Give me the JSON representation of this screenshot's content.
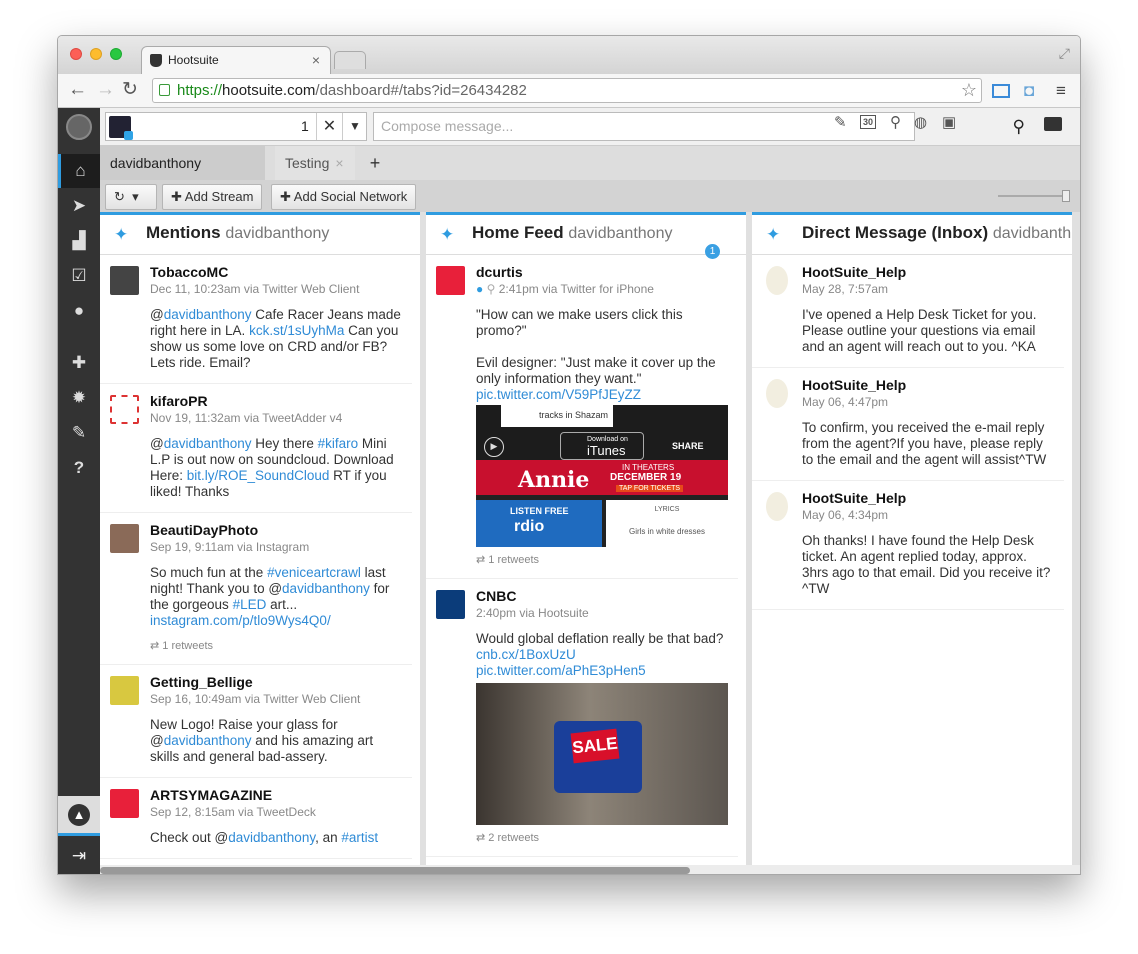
{
  "browser": {
    "tab_title": "Hootsuite",
    "tab_close": "×",
    "url_scheme": "https://",
    "url_host": "hootsuite.com",
    "url_path": "/dashboard#/tabs?id=26434282"
  },
  "compose": {
    "profile_count": "1",
    "placeholder": "Compose message...",
    "calendar_day": "30"
  },
  "tabs": [
    {
      "label": "davidbanthony (Twitter)",
      "close": "×"
    },
    {
      "label": "Testing",
      "close": "×"
    }
  ],
  "add_tab": "+",
  "actions": {
    "add_stream": "Add Stream",
    "add_social_network": "Add Social Network"
  },
  "columns": [
    {
      "title": "Mentions",
      "user": "davidbanthony",
      "messages": [
        {
          "name": "TobaccoMC",
          "meta": "Dec 11, 10:23am via Twitter Web Client",
          "parts": [
            "@",
            "davidbanthony",
            " Cafe Racer Jeans made right here in LA. ",
            "kck.st/1sUyhMa",
            " Can you show us some love on CRD and/or FB? Lets ride. Email?"
          ]
        },
        {
          "name": "kifaroPR",
          "meta": "Nov 19, 11:32am via TweetAdder v4",
          "parts": [
            "@",
            "davidbanthony",
            " Hey there ",
            "#kifaro",
            " Mini L.P is out now on soundcloud. Download Here: ",
            "bit.ly/ROE_SoundCloud",
            " RT if you liked! Thanks"
          ]
        },
        {
          "name": "BeautiDayPhoto",
          "meta": "Sep 19, 9:11am via Instagram",
          "parts": [
            "So much fun at the ",
            "#veniceartcrawl",
            " last night! Thank you to @",
            "davidbanthony",
            " for the gorgeous ",
            "#LED",
            " art... ",
            "instagram.com/p/tlo9Wys4Q0/",
            ""
          ],
          "retweets": "1 retweets"
        },
        {
          "name": "Getting_Bellige",
          "meta": "Sep 16, 10:49am via Twitter Web Client",
          "parts": [
            "New Logo! Raise your glass for @",
            "davidbanthony",
            " and his amazing art skills and general bad-assery."
          ]
        },
        {
          "name": "ARTSYMAGAZINE",
          "meta": "Sep 12, 8:15am via TweetDeck",
          "parts": [
            "Check out @",
            "davidbanthony",
            ", an ",
            "#artist",
            ""
          ]
        }
      ]
    },
    {
      "title": "Home Feed",
      "user": "davidbanthony",
      "badge": "1",
      "messages": [
        {
          "name": "dcurtis",
          "meta": "2:41pm via Twitter for iPhone",
          "parts": [
            "\"How can we make users click this promo?\"\n\nEvil designer: \"Just make it cover up the only information they want.\"\n",
            "pic.twitter.com/V59PfJEyZZ",
            ""
          ],
          "media": {
            "itunes_small": "Download on",
            "itunes": "iTunes",
            "share": "SHARE",
            "shazam": "tracks in Shazam",
            "movie": "Annie",
            "in_theaters": "IN THEATERS",
            "date": "DECEMBER 19",
            "tickets": "TAP FOR TICKETS",
            "listen": "LISTEN FREE",
            "rdio": "rdio",
            "lyrics": "LYRICS",
            "lyric_line": "Girls in white dresses"
          },
          "retweets": "1 retweets"
        },
        {
          "name": "CNBC",
          "meta": "2:40pm via Hootsuite",
          "parts": [
            "Would global deflation really be that bad? ",
            "cnb.cx/1BoxUzU",
            "\n",
            "pic.twitter.com/aPhE3pHen5",
            ""
          ],
          "media": {
            "sale": "SALE"
          },
          "retweets": "2 retweets"
        }
      ]
    },
    {
      "title": "Direct Message (Inbox)",
      "user": "davidbanth…",
      "messages": [
        {
          "name": "HootSuite_Help",
          "meta": "May 28, 7:57am",
          "parts": [
            "I've opened a Help Desk Ticket for you. Please outline your questions via email and an agent will reach out to you. ^KA"
          ]
        },
        {
          "name": "HootSuite_Help",
          "meta": "May 06, 4:47pm",
          "parts": [
            "To confirm, you received the e-mail reply from the agent?If you have, please reply to the email and the agent will assist^TW"
          ]
        },
        {
          "name": "HootSuite_Help",
          "meta": "May 06, 4:34pm",
          "parts": [
            "Oh thanks! I have found the Help Desk ticket. An agent replied today, approx. 3hrs ago to that email. Did you receive it? ^TW"
          ]
        }
      ]
    }
  ],
  "colors": {
    "accent": "#2f9ce0",
    "link": "#2f8bd6",
    "nav": "#333333"
  }
}
